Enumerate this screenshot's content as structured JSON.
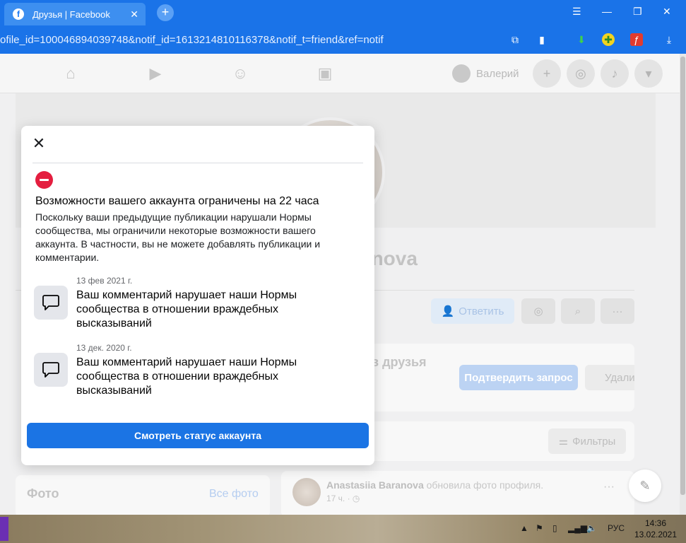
{
  "browser": {
    "tab_title": "Друзья | Facebook",
    "tab_close": "✕",
    "new_tab": "+",
    "url": "ofile_id=100046894039748&notif_id=1613214810116378&notif_t=friend&ref=notif"
  },
  "fb_nav": {
    "user_name": "Валерий"
  },
  "profile": {
    "name_partial": "anova",
    "reply_button": "Ответить"
  },
  "friend_request": {
    "text_partial": "е в друзья",
    "confirm_button": "Подтвердить запрос",
    "delete_partial": "Удали"
  },
  "filters_button": "Фильтры",
  "photos": {
    "title": "Фото",
    "all_link": "Все фото"
  },
  "post": {
    "author": "Anastasiia Baranova",
    "action": "обновила фото профиля.",
    "time": "17 ч. · ◷"
  },
  "dialog": {
    "close": "✕",
    "title": "Возможности вашего аккаунта ограничены на 22 часа",
    "body": "Поскольку ваши предыдущие публикации нарушали Нормы сообщества, мы ограничили некоторые возможности вашего аккаунта. В частности, вы не можете добавлять публикации и комментарии.",
    "items": [
      {
        "date": "13 фев 2021 г.",
        "text": "Ваш комментарий нарушает наши Нормы сообщества в отношении враждебных высказываний"
      },
      {
        "date": "13 дек. 2020 г.",
        "text": "Ваш комментарий нарушает наши Нормы сообщества в отношении враждебных высказываний"
      }
    ],
    "button": "Смотреть статус аккаунта"
  },
  "taskbar": {
    "language": "РУС",
    "time": "14:36",
    "date": "13.02.2021"
  },
  "colors": {
    "fb_blue": "#1b74e4",
    "browser_blue": "#1a73e8",
    "stop_red": "#e41e3f"
  }
}
